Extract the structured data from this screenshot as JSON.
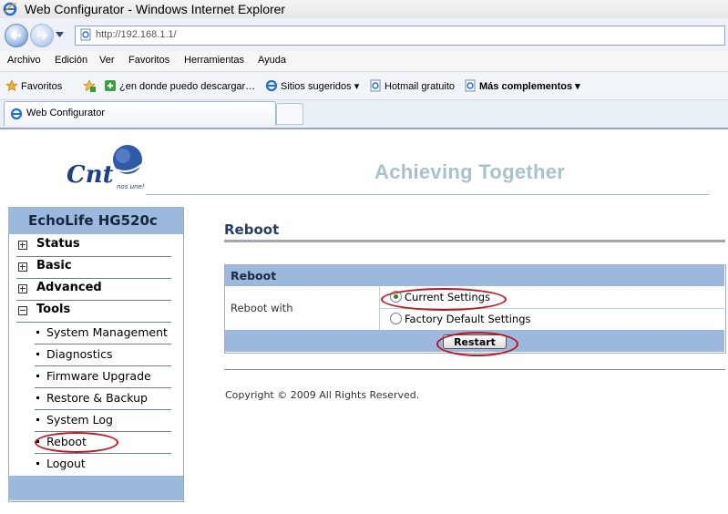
{
  "window": {
    "title": "Web Configurator - Windows Internet Explorer"
  },
  "address": {
    "url": "http://192.168.1.1/"
  },
  "menu": [
    "Archivo",
    "Edición",
    "Ver",
    "Favoritos",
    "Herramientas",
    "Ayuda"
  ],
  "favorites_bar": {
    "favorites_label": "Favoritos",
    "items": [
      "¿en donde puedo descargar…",
      "Sitios sugeridos",
      "Hotmail gratuito",
      "Más complementos"
    ]
  },
  "tab": {
    "title": "Web Configurator"
  },
  "header": {
    "logo_tagline": "nos une!",
    "tagline": "Achieving Together"
  },
  "sidebar": {
    "device": "EchoLife HG520c",
    "sections": [
      {
        "label": "Status",
        "expanded": false
      },
      {
        "label": "Basic",
        "expanded": false
      },
      {
        "label": "Advanced",
        "expanded": false
      },
      {
        "label": "Tools",
        "expanded": true
      }
    ],
    "tools_items": [
      "System Management",
      "Diagnostics",
      "Firmware Upgrade",
      "Restore & Backup",
      "System Log",
      "Reboot",
      "Logout"
    ]
  },
  "main": {
    "page_title": "Reboot",
    "panel_title": "Reboot",
    "row_label": "Reboot with",
    "options": [
      {
        "label": "Current Settings",
        "selected": true
      },
      {
        "label": "Factory Default Settings",
        "selected": false
      }
    ],
    "restart_button": "Restart",
    "copyright": "Copyright © 2009 All Rights Reserved."
  },
  "colors": {
    "accent_blue": "#9cb9dd",
    "highlight_red": "#c0141e",
    "tagline": "#a8c2cc"
  }
}
